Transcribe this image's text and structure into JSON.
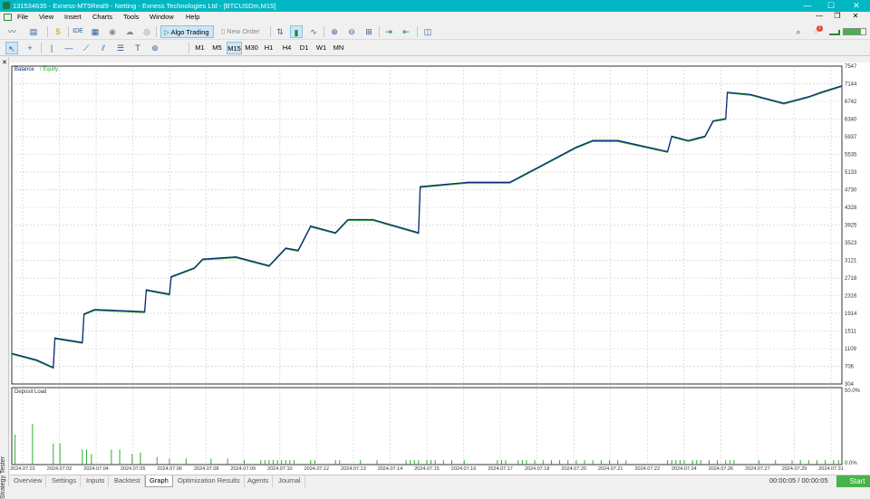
{
  "window": {
    "title": "131534635 - Exness-MT5Real9 - Netting - Exness Technologies Ltd - [BTCUSDm,M15]",
    "controls": [
      "—",
      "☐",
      "✕"
    ]
  },
  "menu": {
    "items": [
      "File",
      "View",
      "Insert",
      "Charts",
      "Tools",
      "Window",
      "Help"
    ]
  },
  "toolbar": {
    "algo_trading_label": "Algo Trading",
    "new_order_label": "New Order",
    "notification_count": "1",
    "timeframes": [
      "M1",
      "M5",
      "M15",
      "M30",
      "H1",
      "H4",
      "D1",
      "W1",
      "MN"
    ],
    "active_timeframe": "M15"
  },
  "sidebar": {
    "vertical_label": "Strategy Tester"
  },
  "chart_data": [
    {
      "type": "line",
      "legend": [
        "Balance",
        "Equity"
      ],
      "colors": {
        "Balance": "#0a2a7a",
        "Equity": "#2eaa2e"
      },
      "ylim": [
        304,
        7547
      ],
      "y_ticks": [
        7547,
        7144,
        6742,
        6340,
        5937,
        5535,
        5133,
        4730,
        4328,
        3925,
        3523,
        3121,
        2718,
        2316,
        1914,
        1511,
        1109,
        706,
        304
      ],
      "x_ticks": [
        "2024.07.01",
        "2024.07.02",
        "2024.07.04",
        "2024.07.05",
        "2024.07.06",
        "2024.07.08",
        "2024.07.09",
        "2024.07.10",
        "2024.07.12",
        "2024.07.13",
        "2024.07.14",
        "2024.07.15",
        "2024.07.16",
        "2024.07.17",
        "2024.07.18",
        "2024.07.20",
        "2024.07.21",
        "2024.07.22",
        "2024.07.24",
        "2024.07.26",
        "2024.07.27",
        "2024.07.29",
        "2024.07.31"
      ],
      "x_range": [
        0,
        1
      ],
      "grid": true,
      "series": [
        {
          "name": "Balance",
          "x": [
            0.0,
            0.03,
            0.05,
            0.052,
            0.085,
            0.087,
            0.1,
            0.16,
            0.162,
            0.19,
            0.192,
            0.22,
            0.23,
            0.27,
            0.31,
            0.33,
            0.345,
            0.36,
            0.39,
            0.405,
            0.435,
            0.49,
            0.492,
            0.55,
            0.6,
            0.62,
            0.64,
            0.68,
            0.7,
            0.73,
            0.79,
            0.795,
            0.815,
            0.835,
            0.845,
            0.86,
            0.862,
            0.89,
            0.93,
            0.96,
            0.975,
            1.0
          ],
          "y": [
            1000,
            850,
            680,
            1350,
            1250,
            1900,
            2000,
            1950,
            2450,
            2350,
            2750,
            2950,
            3150,
            3200,
            3000,
            3400,
            3350,
            3900,
            3750,
            4050,
            4050,
            3750,
            4800,
            4900,
            4900,
            5100,
            5300,
            5700,
            5850,
            5850,
            5600,
            5950,
            5850,
            5950,
            6300,
            6350,
            6950,
            6900,
            6700,
            6850,
            6950,
            7100
          ]
        },
        {
          "name": "Equity",
          "x": [
            0.0,
            0.03,
            0.05,
            0.052,
            0.085,
            0.087,
            0.1,
            0.16,
            0.162,
            0.19,
            0.192,
            0.22,
            0.23,
            0.27,
            0.31,
            0.33,
            0.345,
            0.36,
            0.39,
            0.405,
            0.435,
            0.49,
            0.492,
            0.55,
            0.6,
            0.62,
            0.64,
            0.68,
            0.7,
            0.73,
            0.79,
            0.795,
            0.815,
            0.835,
            0.845,
            0.86,
            0.862,
            0.89,
            0.93,
            0.96,
            0.975,
            1.0
          ],
          "y": [
            980,
            830,
            660,
            1330,
            1230,
            1880,
            1980,
            1930,
            2430,
            2330,
            2730,
            2930,
            3130,
            3180,
            2980,
            3380,
            3330,
            3880,
            3730,
            4030,
            4030,
            3730,
            4780,
            4880,
            4880,
            5080,
            5280,
            5680,
            5830,
            5830,
            5580,
            5930,
            5830,
            5930,
            6280,
            6330,
            6930,
            6880,
            6680,
            6830,
            6930,
            7080
          ]
        }
      ]
    },
    {
      "type": "bar",
      "title": "Deposit Load",
      "y_ticks": [
        "50.0%",
        "0.0%"
      ],
      "ylim": [
        0,
        50
      ],
      "bars": [
        {
          "x": 0.004,
          "v": 20
        },
        {
          "x": 0.025,
          "v": 27
        },
        {
          "x": 0.05,
          "v": 14
        },
        {
          "x": 0.058,
          "v": 14
        },
        {
          "x": 0.085,
          "v": 10
        },
        {
          "x": 0.09,
          "v": 10
        },
        {
          "x": 0.096,
          "v": 7
        },
        {
          "x": 0.12,
          "v": 10
        },
        {
          "x": 0.13,
          "v": 10
        },
        {
          "x": 0.145,
          "v": 7
        },
        {
          "x": 0.155,
          "v": 8
        },
        {
          "x": 0.175,
          "v": 5
        },
        {
          "x": 0.19,
          "v": 4
        },
        {
          "x": 0.21,
          "v": 4
        },
        {
          "x": 0.24,
          "v": 4
        },
        {
          "x": 0.26,
          "v": 4
        },
        {
          "x": 0.28,
          "v": 3
        },
        {
          "x": 0.3,
          "v": 3
        },
        {
          "x": 0.305,
          "v": 3
        },
        {
          "x": 0.31,
          "v": 3
        },
        {
          "x": 0.315,
          "v": 3
        },
        {
          "x": 0.32,
          "v": 3
        },
        {
          "x": 0.325,
          "v": 3
        },
        {
          "x": 0.33,
          "v": 3
        },
        {
          "x": 0.335,
          "v": 3
        },
        {
          "x": 0.34,
          "v": 3
        },
        {
          "x": 0.36,
          "v": 3
        },
        {
          "x": 0.365,
          "v": 3
        },
        {
          "x": 0.39,
          "v": 3
        },
        {
          "x": 0.395,
          "v": 3
        },
        {
          "x": 0.42,
          "v": 3
        },
        {
          "x": 0.44,
          "v": 3
        },
        {
          "x": 0.475,
          "v": 3
        },
        {
          "x": 0.48,
          "v": 3
        },
        {
          "x": 0.485,
          "v": 3
        },
        {
          "x": 0.49,
          "v": 3
        },
        {
          "x": 0.5,
          "v": 3
        },
        {
          "x": 0.505,
          "v": 3
        },
        {
          "x": 0.51,
          "v": 3
        },
        {
          "x": 0.52,
          "v": 3
        },
        {
          "x": 0.53,
          "v": 3
        },
        {
          "x": 0.545,
          "v": 3
        },
        {
          "x": 0.585,
          "v": 3
        },
        {
          "x": 0.59,
          "v": 3
        },
        {
          "x": 0.595,
          "v": 3
        },
        {
          "x": 0.61,
          "v": 3
        },
        {
          "x": 0.615,
          "v": 3
        },
        {
          "x": 0.62,
          "v": 3
        },
        {
          "x": 0.63,
          "v": 3
        },
        {
          "x": 0.64,
          "v": 3
        },
        {
          "x": 0.65,
          "v": 3
        },
        {
          "x": 0.66,
          "v": 3
        },
        {
          "x": 0.67,
          "v": 3
        },
        {
          "x": 0.68,
          "v": 3
        },
        {
          "x": 0.69,
          "v": 3
        },
        {
          "x": 0.7,
          "v": 3
        },
        {
          "x": 0.71,
          "v": 3
        },
        {
          "x": 0.72,
          "v": 3
        },
        {
          "x": 0.73,
          "v": 3
        },
        {
          "x": 0.74,
          "v": 3
        },
        {
          "x": 0.79,
          "v": 3
        },
        {
          "x": 0.795,
          "v": 3
        },
        {
          "x": 0.8,
          "v": 3
        },
        {
          "x": 0.805,
          "v": 3
        },
        {
          "x": 0.81,
          "v": 3
        },
        {
          "x": 0.82,
          "v": 3
        },
        {
          "x": 0.825,
          "v": 3
        },
        {
          "x": 0.83,
          "v": 3
        },
        {
          "x": 0.84,
          "v": 3
        },
        {
          "x": 0.85,
          "v": 3
        },
        {
          "x": 0.86,
          "v": 3
        },
        {
          "x": 0.865,
          "v": 3
        },
        {
          "x": 0.87,
          "v": 3
        },
        {
          "x": 0.9,
          "v": 3
        },
        {
          "x": 0.92,
          "v": 3
        },
        {
          "x": 0.94,
          "v": 3
        },
        {
          "x": 0.95,
          "v": 3
        },
        {
          "x": 0.96,
          "v": 3
        },
        {
          "x": 0.97,
          "v": 3
        },
        {
          "x": 0.98,
          "v": 3
        },
        {
          "x": 0.99,
          "v": 3
        },
        {
          "x": 0.996,
          "v": 3
        }
      ]
    }
  ],
  "tabs": [
    "Overview",
    "Settings",
    "Inputs",
    "Backtest",
    "Graph",
    "Optimization Results",
    "Agents",
    "Journal"
  ],
  "active_tab": "Graph",
  "status": {
    "timer": "00:00:05 / 00:00:05",
    "start_label": "Start"
  }
}
